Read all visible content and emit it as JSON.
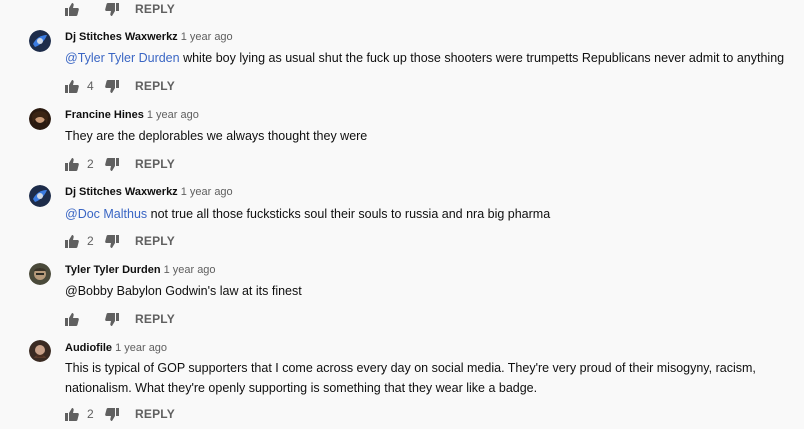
{
  "labels": {
    "reply": "REPLY"
  },
  "top_actions": {
    "likes": ""
  },
  "comments": [
    {
      "author": "Dj Stitches Waxwerkz",
      "time": "1 year ago",
      "mention": "@Tyler Tyler Durden",
      "text": " white boy lying as usual shut the fuck up those shooters were trumpetts Republicans never admit to anything",
      "likes": "4"
    },
    {
      "author": "Francine Hines",
      "time": "1 year ago",
      "mention": "",
      "text": "They are the deplorables we always thought they were",
      "likes": "2"
    },
    {
      "author": "Dj Stitches Waxwerkz",
      "time": "1 year ago",
      "mention": "@Doc Malthus",
      "text": " not true all those fucksticks soul their souls to russia and nra big pharma",
      "likes": "2"
    },
    {
      "author": "Tyler Tyler Durden",
      "time": "1 year ago",
      "mention": "",
      "text": "@Bobby  Babylon Godwin's law at its finest",
      "likes": ""
    },
    {
      "author": "Audiofile",
      "time": "1 year ago",
      "mention": "",
      "text": "This is typical of GOP supporters that I come across every day on social media. They're very proud of their misogyny, racism, nationalism. What they're openly supporting is something that they wear like a badge.",
      "likes": "2"
    }
  ],
  "colors": {
    "background": "#f9f9f9",
    "mention": "#3a66c4",
    "muted": "#606060"
  },
  "icons": {
    "like": "thumb-up-icon",
    "dislike": "thumb-down-icon"
  }
}
